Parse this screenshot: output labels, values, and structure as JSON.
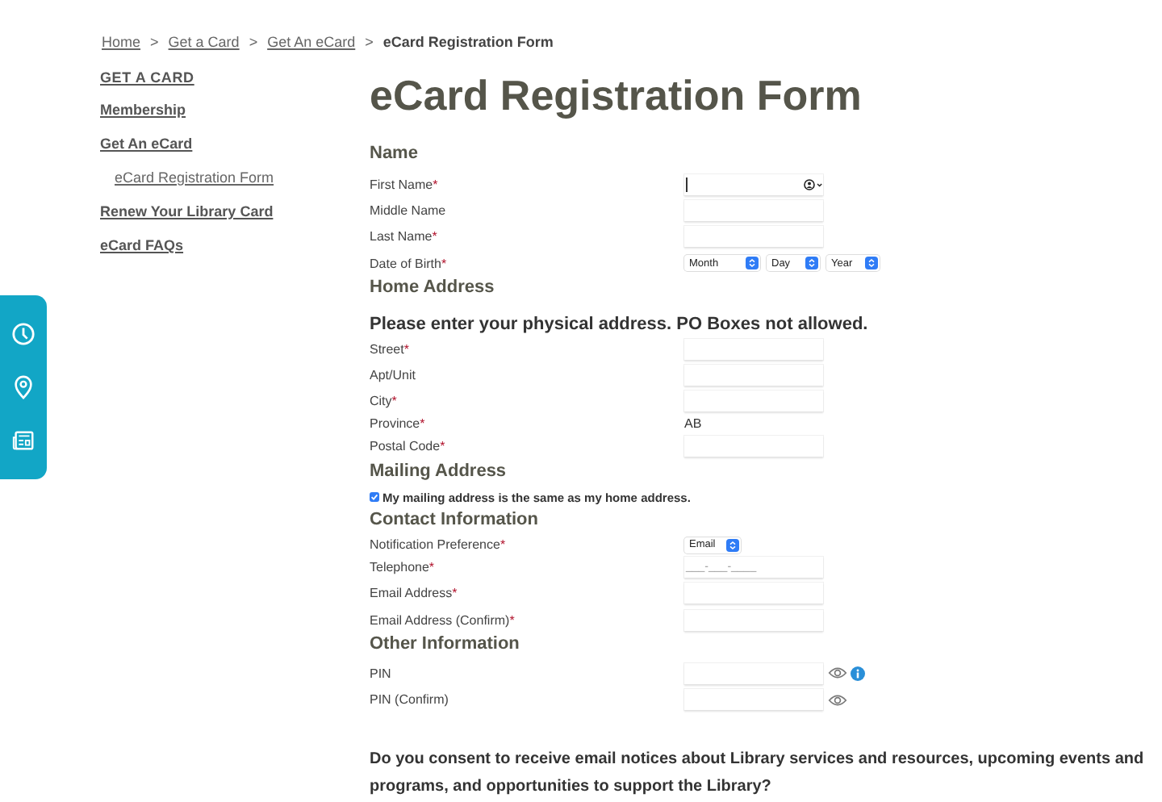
{
  "breadcrumb": [
    {
      "label": "Home",
      "kind": "link"
    },
    {
      "label": "Get a Card",
      "kind": "link"
    },
    {
      "label": "Get An eCard",
      "kind": "link"
    },
    {
      "label": "eCard Registration Form",
      "kind": "current"
    }
  ],
  "breadcrumb_separator": ">",
  "sidebar": {
    "title": "GET A CARD",
    "items": [
      {
        "label": "Membership"
      },
      {
        "label": "Get An eCard",
        "children": [
          {
            "label": "eCard Registration Form"
          }
        ]
      },
      {
        "label": "Renew Your Library Card"
      },
      {
        "label": "eCard FAQs"
      }
    ]
  },
  "page_title": "eCard Registration Form",
  "required_mark": "*",
  "sections": [
    {
      "title": "Name",
      "fields": [
        {
          "label": "First Name",
          "required": true,
          "kind": "text",
          "focused": true
        },
        {
          "label": "Middle Name",
          "required": false,
          "kind": "text"
        },
        {
          "label": "Last Name",
          "required": true,
          "kind": "text"
        },
        {
          "label": "Date of Birth",
          "required": true,
          "kind": "selects",
          "options": [
            "Month",
            "Day",
            "Year"
          ]
        }
      ]
    },
    {
      "title": "Home Address",
      "note": "Please enter your physical address. PO Boxes not allowed.",
      "fields": [
        {
          "label": "Street",
          "required": true,
          "kind": "text"
        },
        {
          "label": "Apt/Unit",
          "required": false,
          "kind": "text"
        },
        {
          "label": "City",
          "required": true,
          "kind": "text"
        },
        {
          "label": "Province",
          "required": true,
          "kind": "static",
          "value": "AB"
        },
        {
          "label": "Postal Code",
          "required": true,
          "kind": "text"
        }
      ]
    },
    {
      "title": "Mailing Address",
      "checkbox": {
        "label": "My mailing address is the same as my home address.",
        "checked": true
      }
    },
    {
      "title": "Contact Information",
      "fields": [
        {
          "label": "Notification Preference",
          "required": true,
          "kind": "select",
          "value": "Email"
        },
        {
          "label": "Telephone",
          "required": true,
          "kind": "text",
          "placeholder": "___-___-____"
        },
        {
          "label": "Email Address",
          "required": true,
          "kind": "text"
        },
        {
          "label": "Email Address (Confirm)",
          "required": true,
          "kind": "text"
        }
      ]
    },
    {
      "title": "Other Information",
      "fields": [
        {
          "label": "PIN",
          "required": false,
          "kind": "password",
          "info": true
        },
        {
          "label": "PIN (Confirm)",
          "required": false,
          "kind": "password",
          "info": false
        }
      ]
    }
  ],
  "consent_question": "Do you consent to receive email notices about Library services and resources, upcoming events and programs, and opportunities to support the Library?"
}
